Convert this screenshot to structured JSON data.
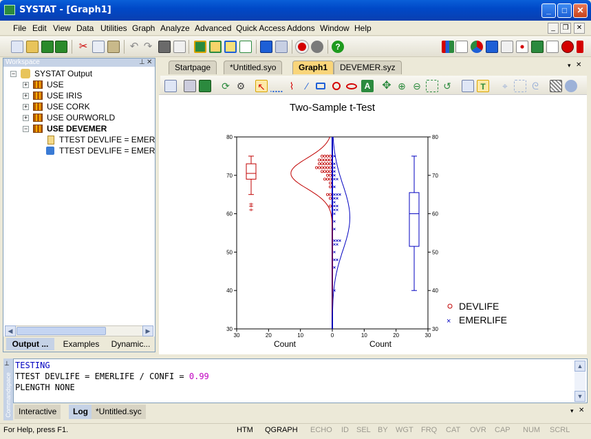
{
  "window": {
    "title": "SYSTAT - [Graph1]"
  },
  "menu": [
    "File",
    "Edit",
    "View",
    "Data",
    "Utilities",
    "Graph",
    "Analyze",
    "Advanced",
    "Quick Access",
    "Addons",
    "Window",
    "Help"
  ],
  "workspace": {
    "header": "Workspace",
    "root": "SYSTAT Output",
    "items": [
      "USE",
      "USE IRIS",
      "USE CORK",
      "USE OURWORLD",
      "USE DEVEMER"
    ],
    "children": [
      "TTEST DEVLIFE = EMERLI",
      "TTEST DEVLIFE = EMERLI"
    ],
    "tabs": [
      "Output ...",
      "Examples",
      "Dynamic..."
    ]
  },
  "doc_tabs": [
    "Startpage",
    "*Untitled.syo",
    "Graph1",
    "DEVEMER.syz"
  ],
  "graph": {
    "title": "Two-Sample t-Test",
    "xlabel_left": "Count",
    "xlabel_right": "Count",
    "legend": [
      {
        "name": "DEVLIFE",
        "marker": "o",
        "color": "#c00000"
      },
      {
        "name": "EMERLIFE",
        "marker": "x",
        "color": "#0000c0"
      }
    ]
  },
  "chart_data": {
    "type": "scatter",
    "title": "Two-Sample t-Test",
    "xlabel": "Count",
    "ylabel": "",
    "ylim": [
      30,
      80
    ],
    "y_ticks": [
      30,
      40,
      50,
      60,
      70,
      80
    ],
    "x_ticks_left": [
      30,
      20,
      10,
      0
    ],
    "x_ticks_right": [
      0,
      10,
      20,
      30
    ],
    "series": [
      {
        "name": "DEVLIFE",
        "color": "#c00000",
        "boxplot": {
          "whisker_low": 65,
          "q1": 69,
          "median": 70.5,
          "q3": 73,
          "whisker_high": 75,
          "outliers": [
            61,
            62,
            62.5
          ]
        },
        "normal_curve": {
          "mean": 70.5,
          "sd": 4,
          "peak_count": 13
        },
        "dot_counts": [
          {
            "y": 75,
            "count": 4
          },
          {
            "y": 74,
            "count": 5
          },
          {
            "y": 73,
            "count": 5
          },
          {
            "y": 72,
            "count": 6
          },
          {
            "y": 71,
            "count": 4
          },
          {
            "y": 70,
            "count": 2
          },
          {
            "y": 69,
            "count": 3
          },
          {
            "y": 68,
            "count": 1
          },
          {
            "y": 67,
            "count": 1
          },
          {
            "y": 65,
            "count": 2
          },
          {
            "y": 64,
            "count": 1
          },
          {
            "y": 62,
            "count": 1
          }
        ]
      },
      {
        "name": "EMERLIFE",
        "color": "#0000c0",
        "boxplot": {
          "whisker_low": 40,
          "q1": 51.5,
          "median": 60,
          "q3": 65.5,
          "whisker_high": 75
        },
        "normal_curve": {
          "mean": 59,
          "sd": 8.5,
          "peak_count": 5.5
        },
        "dot_counts": [
          {
            "y": 75,
            "count": 1
          },
          {
            "y": 73,
            "count": 1
          },
          {
            "y": 72,
            "count": 1
          },
          {
            "y": 71,
            "count": 1
          },
          {
            "y": 70,
            "count": 1
          },
          {
            "y": 69,
            "count": 2
          },
          {
            "y": 67,
            "count": 1
          },
          {
            "y": 65,
            "count": 3
          },
          {
            "y": 64,
            "count": 2
          },
          {
            "y": 63,
            "count": 1
          },
          {
            "y": 62,
            "count": 2
          },
          {
            "y": 61,
            "count": 2
          },
          {
            "y": 60,
            "count": 1
          },
          {
            "y": 58,
            "count": 1
          },
          {
            "y": 56,
            "count": 1
          },
          {
            "y": 53,
            "count": 3
          },
          {
            "y": 52,
            "count": 2
          },
          {
            "y": 50,
            "count": 1
          },
          {
            "y": 48,
            "count": 2
          },
          {
            "y": 46,
            "count": 1
          },
          {
            "y": 40,
            "count": 1
          }
        ]
      }
    ]
  },
  "commandspace": {
    "side_label": "Commandspace",
    "lines": [
      {
        "text": "TESTING",
        "color": "#0000c0"
      },
      {
        "text": "TTEST DEVLIFE = EMERLIFE / CONFI = ",
        "extra": "0.99",
        "color": "#000000",
        "extra_color": "#c000c0"
      },
      {
        "text": "PLENGTH NONE",
        "color": "#000000"
      }
    ],
    "tabs": [
      "Interactive",
      "Log",
      "*Untitled.syc"
    ]
  },
  "status": {
    "help": "For Help, press F1.",
    "indicators": [
      {
        "label": "HTM",
        "on": true
      },
      {
        "label": "QGRAPH",
        "on": true
      },
      {
        "label": "ECHO",
        "on": false
      },
      {
        "label": "ID",
        "on": false
      },
      {
        "label": "SEL",
        "on": false
      },
      {
        "label": "BY",
        "on": false
      },
      {
        "label": "WGT",
        "on": false
      },
      {
        "label": "FRQ",
        "on": false
      },
      {
        "label": "CAT",
        "on": false
      },
      {
        "label": "OVR",
        "on": false
      },
      {
        "label": "CAP",
        "on": false
      },
      {
        "label": "NUM",
        "on": false
      },
      {
        "label": "SCRL",
        "on": false
      }
    ]
  }
}
